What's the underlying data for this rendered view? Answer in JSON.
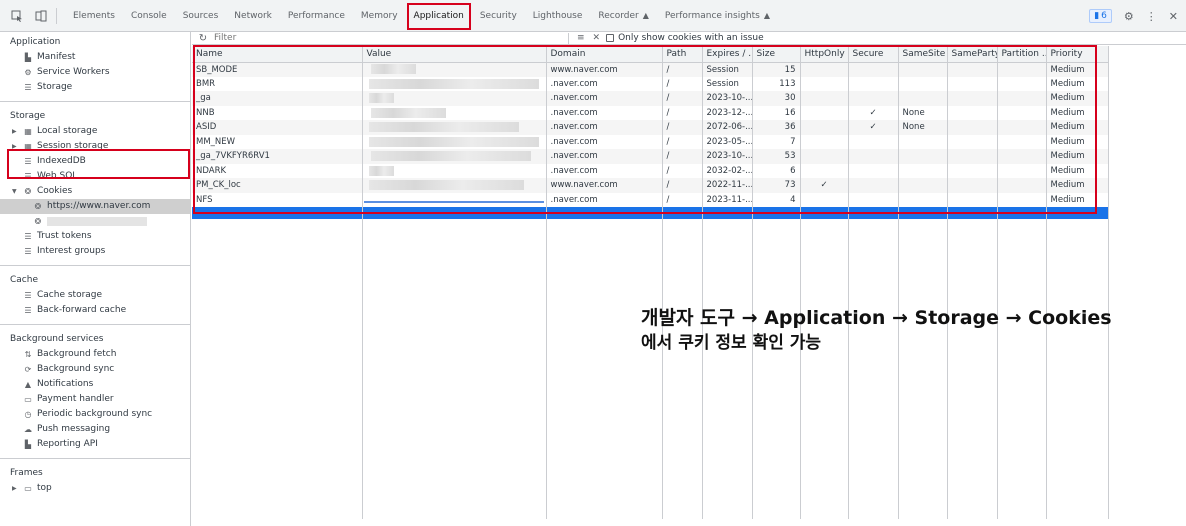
{
  "topbar": {
    "tabs": [
      {
        "label": "Elements"
      },
      {
        "label": "Console"
      },
      {
        "label": "Sources"
      },
      {
        "label": "Network"
      },
      {
        "label": "Performance"
      },
      {
        "label": "Memory"
      },
      {
        "label": "Application"
      },
      {
        "label": "Security"
      },
      {
        "label": "Lighthouse"
      },
      {
        "label": "Recorder"
      },
      {
        "label": "Performance insights"
      }
    ],
    "issues_count": "6"
  },
  "sidebar": {
    "application_title": "Application",
    "application_items": [
      "Manifest",
      "Service Workers",
      "Storage"
    ],
    "storage_title": "Storage",
    "storage_items": [
      "Local storage",
      "Session storage",
      "IndexedDB",
      "Web SQL",
      "Cookies",
      "https://www.naver.com",
      "Trust tokens",
      "Interest groups"
    ],
    "cache_title": "Cache",
    "cache_items": [
      "Cache storage",
      "Back-forward cache"
    ],
    "bg_title": "Background services",
    "bg_items": [
      "Background fetch",
      "Background sync",
      "Notifications",
      "Payment handler",
      "Periodic background sync",
      "Push messaging",
      "Reporting API"
    ],
    "frames_title": "Frames",
    "frames_items": [
      "top"
    ]
  },
  "filter": {
    "placeholder": "Filter",
    "only_issue_label": "Only show cookies with an issue"
  },
  "table": {
    "headers": [
      "Name",
      "Value",
      "Domain",
      "Path",
      "Expires / ...",
      "Size",
      "HttpOnly",
      "Secure",
      "SameSite",
      "SameParty",
      "Partition ...",
      "Priority"
    ],
    "rows": [
      {
        "name": "SB_MODE",
        "domain": "www.naver.com",
        "path": "/",
        "expires": "Session",
        "size": "15",
        "httponly": "",
        "secure": "",
        "samesite": "",
        "priority": "Medium"
      },
      {
        "name": "BMR",
        "domain": ".naver.com",
        "path": "/",
        "expires": "Session",
        "size": "113",
        "httponly": "",
        "secure": "",
        "samesite": "",
        "priority": "Medium"
      },
      {
        "name": "_ga",
        "domain": ".naver.com",
        "path": "/",
        "expires": "2023-10-...",
        "size": "30",
        "httponly": "",
        "secure": "",
        "samesite": "",
        "priority": "Medium"
      },
      {
        "name": "NNB",
        "domain": ".naver.com",
        "path": "/",
        "expires": "2023-12-...",
        "size": "16",
        "httponly": "",
        "secure": "✓",
        "samesite": "None",
        "priority": "Medium"
      },
      {
        "name": "ASID",
        "domain": ".naver.com",
        "path": "/",
        "expires": "2072-06-...",
        "size": "36",
        "httponly": "",
        "secure": "✓",
        "samesite": "None",
        "priority": "Medium"
      },
      {
        "name": "MM_NEW",
        "domain": ".naver.com",
        "path": "/",
        "expires": "2023-05-...",
        "size": "7",
        "httponly": "",
        "secure": "",
        "samesite": "",
        "priority": "Medium"
      },
      {
        "name": "_ga_7VKFYR6RV1",
        "domain": ".naver.com",
        "path": "/",
        "expires": "2023-10-...",
        "size": "53",
        "httponly": "",
        "secure": "",
        "samesite": "",
        "priority": "Medium"
      },
      {
        "name": "NDARK",
        "domain": ".naver.com",
        "path": "/",
        "expires": "2032-02-...",
        "size": "6",
        "httponly": "",
        "secure": "",
        "samesite": "",
        "priority": "Medium"
      },
      {
        "name": "PM_CK_loc",
        "domain": "www.naver.com",
        "path": "/",
        "expires": "2022-11-...",
        "size": "73",
        "httponly": "✓",
        "secure": "",
        "samesite": "",
        "priority": "Medium"
      },
      {
        "name": "NFS",
        "domain": ".naver.com",
        "path": "/",
        "expires": "2023-11-...",
        "size": "4",
        "httponly": "",
        "secure": "",
        "samesite": "",
        "priority": "Medium"
      }
    ]
  },
  "annotation": {
    "line1": "개발자 도구 → Application → Storage → Cookies",
    "line2": "에서 쿠키 정보 확인 가능"
  },
  "colors": {
    "highlight": "#d6001c",
    "selection": "#1a73e8"
  }
}
